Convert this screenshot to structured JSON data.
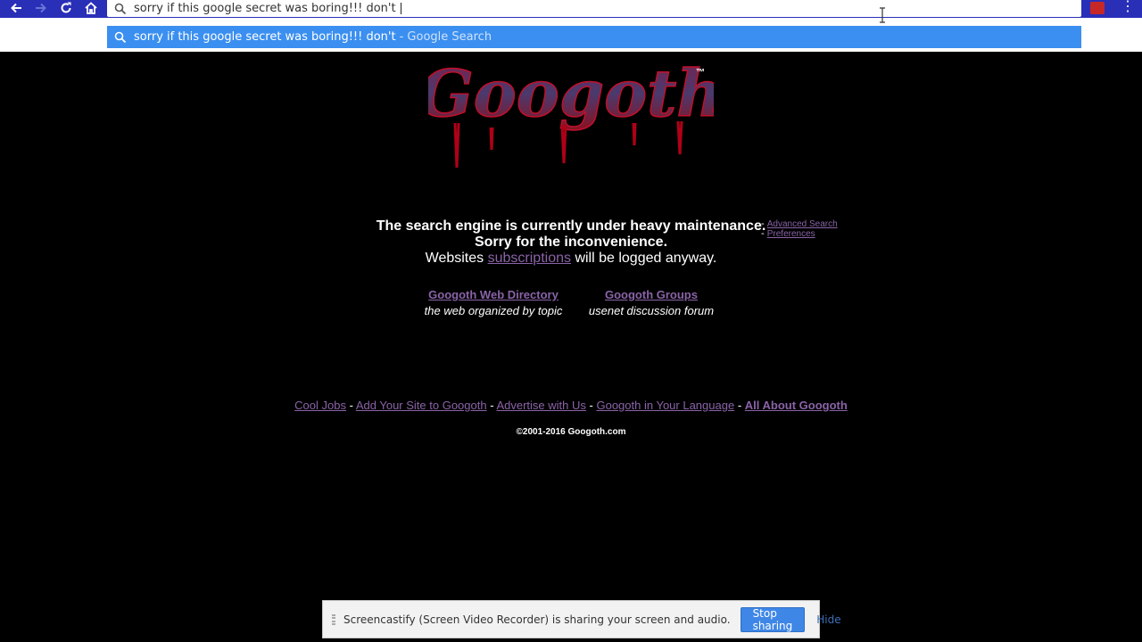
{
  "browser": {
    "omnibox_text": "sorry if this google secret was boring!!! don't ",
    "suggestion_text": "sorry if this google secret was boring!!! don't",
    "suggestion_source": "- Google Search",
    "nav_icons": [
      "back-arrow-icon",
      "forward-arrow-icon",
      "reload-icon",
      "home-icon"
    ],
    "toolbar_color": "#2a2fb8",
    "suggestion_color": "#3b8ff0"
  },
  "page": {
    "logo_text": "Googoth",
    "logo_tm": "™",
    "notice": {
      "line1": "The search engine is currently under heavy maintenance.",
      "line2": "Sorry for the inconvenience.",
      "line3_pre": "Websites",
      "line3_link": "subscriptions",
      "line3_post": "will be logged anyway."
    },
    "side_links": {
      "separator": "-",
      "advanced_search": "Advanced Search",
      "preferences": "Preferences"
    },
    "services": [
      {
        "title": "Googoth Web Directory",
        "desc": "the web organized by topic"
      },
      {
        "title": "Googoth Groups",
        "desc": "usenet discussion forum"
      }
    ],
    "footer_links": {
      "cool_jobs": "Cool Jobs",
      "add_site": "Add Your Site to Googoth",
      "advertise": "Advertise with Us",
      "language": "Googoth in Your Language",
      "about": "All About Googoth",
      "separator": "-"
    },
    "copyright": "©2001-2016 Googoth.com",
    "link_color": "#8a63a8"
  },
  "share_bar": {
    "message": "Screencastify (Screen Video Recorder) is sharing your screen and audio.",
    "stop_label": "Stop sharing",
    "hide_label": "Hide"
  }
}
